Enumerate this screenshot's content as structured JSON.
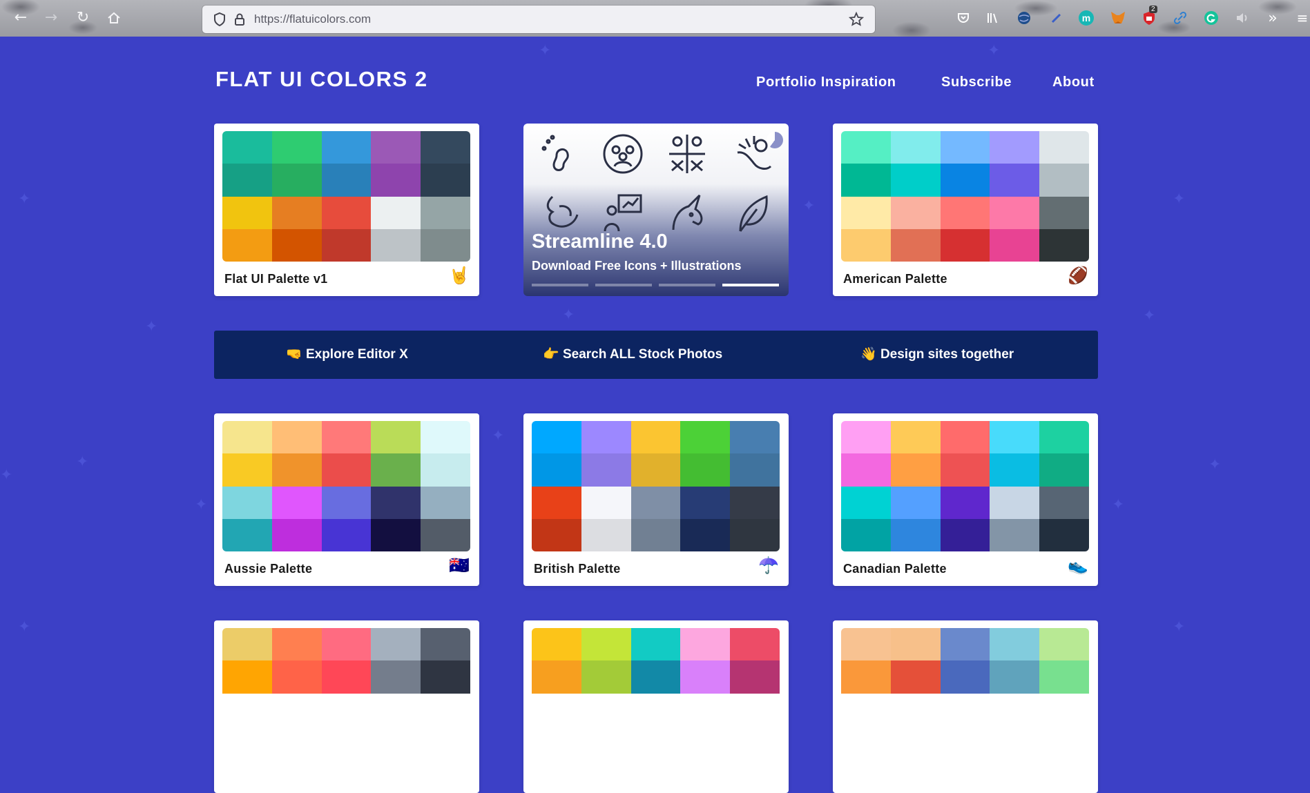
{
  "browser": {
    "url": "https://flatuicolors.com",
    "badge_count": "2",
    "extension_m_letter": "m"
  },
  "site": {
    "logo": "FLAT UI COLORS 2",
    "nav": [
      "Portfolio Inspiration",
      "Subscribe",
      "About"
    ]
  },
  "ad": {
    "title": "Streamline 4.0",
    "subtitle": "Download Free Icons + Illustrations",
    "slides": 4,
    "active_slide": 4
  },
  "promo": {
    "links": [
      {
        "emoji": "🤜",
        "label": "Explore Editor X"
      },
      {
        "emoji": "👉",
        "label": "Search ALL Stock Photos"
      },
      {
        "emoji": "👋",
        "label": "Design sites together"
      }
    ]
  },
  "palettes": [
    {
      "name": "Flat UI Palette v1",
      "emoji": "🤘",
      "colors": [
        "#1abc9c",
        "#2ecc71",
        "#3498db",
        "#9b59b6",
        "#34495e",
        "#16a085",
        "#27ae60",
        "#2980b9",
        "#8e44ad",
        "#2c3e50",
        "#f1c40f",
        "#e67e22",
        "#e74c3c",
        "#ecf0f1",
        "#95a5a6",
        "#f39c12",
        "#d35400",
        "#c0392b",
        "#bdc3c7",
        "#7f8c8d"
      ]
    },
    {
      "name": "American Palette",
      "emoji": "🏈",
      "colors": [
        "#55efc4",
        "#81ecec",
        "#74b9ff",
        "#a29bfe",
        "#dfe6e9",
        "#00b894",
        "#00cec9",
        "#0984e3",
        "#6c5ce7",
        "#b2bec3",
        "#ffeaa7",
        "#fab1a0",
        "#ff7675",
        "#fd79a8",
        "#636e72",
        "#fdcb6e",
        "#e17055",
        "#d63031",
        "#e84393",
        "#2d3436"
      ]
    },
    {
      "name": "Aussie Palette",
      "emoji": "🇦🇺",
      "colors": [
        "#f6e58d",
        "#ffbe76",
        "#ff7979",
        "#badc58",
        "#dff9fb",
        "#f9ca24",
        "#f0932b",
        "#eb4d4b",
        "#6ab04c",
        "#c7ecee",
        "#7ed6df",
        "#e056fd",
        "#686de0",
        "#30336b",
        "#95afc0",
        "#22a6b3",
        "#be2edd",
        "#4834d4",
        "#130f40",
        "#535c68"
      ]
    },
    {
      "name": "British Palette",
      "emoji": "☂️",
      "colors": [
        "#00a8ff",
        "#9c88ff",
        "#fbc531",
        "#4cd137",
        "#487eb0",
        "#0097e6",
        "#8c7ae6",
        "#e1b12c",
        "#44bd32",
        "#40739e",
        "#e84118",
        "#f5f6fa",
        "#7f8fa6",
        "#273c75",
        "#353b48",
        "#c23616",
        "#dcdde1",
        "#718093",
        "#192a56",
        "#2f3640"
      ]
    },
    {
      "name": "Canadian Palette",
      "emoji": "👟",
      "colors": [
        "#ff9ff3",
        "#feca57",
        "#ff6b6b",
        "#48dbfb",
        "#1dd1a1",
        "#f368e0",
        "#ff9f43",
        "#ee5253",
        "#0abde3",
        "#10ac84",
        "#00d2d3",
        "#54a0ff",
        "#5f27cd",
        "#c8d6e5",
        "#576574",
        "#01a3a4",
        "#2e86de",
        "#341f97",
        "#8395a7",
        "#222f3e"
      ]
    },
    {
      "name": "",
      "emoji": "",
      "colors": [
        "#eccc68",
        "#ff7f50",
        "#ff6b81",
        "#a4b0be",
        "#57606f",
        "#ffa502",
        "#ff6348",
        "#ff4757",
        "#747d8c",
        "#2f3542"
      ]
    },
    {
      "name": "",
      "emoji": "",
      "colors": [
        "#fcc419",
        "#c4e538",
        "#12cbc4",
        "#fda7df",
        "#ed4c67",
        "#f79f1f",
        "#a3cb38",
        "#1289a7",
        "#d980fa",
        "#b53471"
      ]
    },
    {
      "name": "",
      "emoji": "",
      "colors": [
        "#f8c291",
        "#f7c08a",
        "#6a89cc",
        "#82ccdd",
        "#b8e994",
        "#fa983a",
        "#e55039",
        "#4a69bd",
        "#60a3bc",
        "#78e08f"
      ]
    }
  ]
}
